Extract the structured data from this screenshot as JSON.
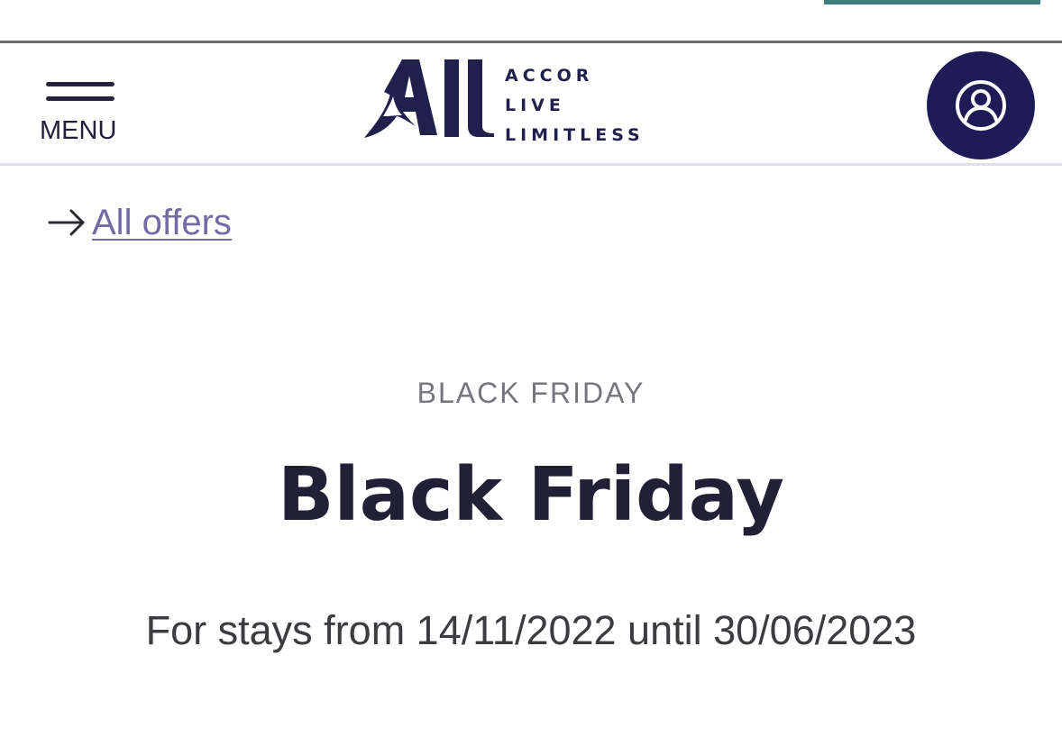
{
  "header": {
    "menu_label": "MENU",
    "logo": {
      "mark_text": "All",
      "lines": [
        "ACCOR",
        "LIVE",
        "LIMITLESS"
      ]
    },
    "account_icon": "user-circle-icon"
  },
  "breadcrumb": {
    "label": "All offers",
    "icon": "arrow-right-icon"
  },
  "offer": {
    "category": "BLACK FRIDAY",
    "title": "Black Friday",
    "dates": "For stays from 14/11/2022 until 30/06/2023"
  },
  "colors": {
    "accent_teal": "#3d7f7d",
    "brand_navy": "#1e1b56",
    "link_purple": "#746ba6",
    "title": "#222037"
  }
}
